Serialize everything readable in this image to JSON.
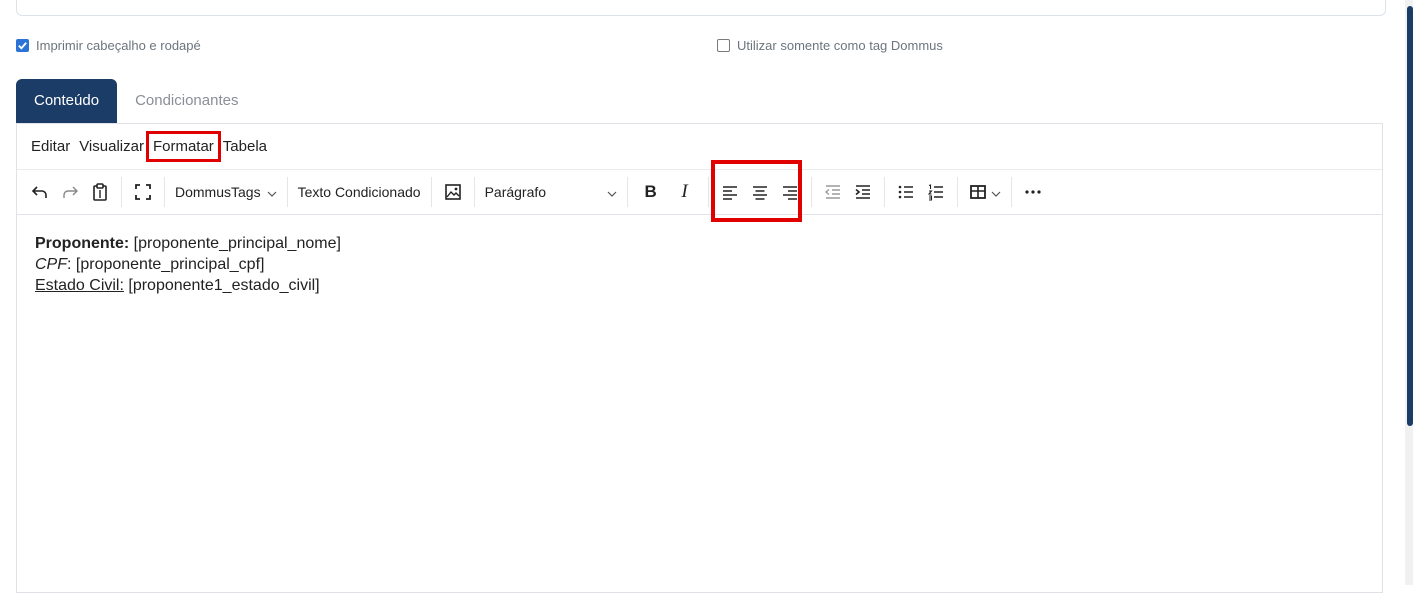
{
  "options": {
    "print_header_footer": {
      "label": "Imprimir cabeçalho e rodapé",
      "checked": true
    },
    "use_as_tag": {
      "label": "Utilizar somente como tag Dommus",
      "checked": false
    }
  },
  "tabs": [
    {
      "label": "Conteúdo",
      "active": true
    },
    {
      "label": "Condicionantes",
      "active": false
    }
  ],
  "menubar": [
    "Editar",
    "Visualizar",
    "Formatar",
    "Tabela"
  ],
  "toolbar": {
    "dommus_tags": "DommusTags",
    "texto_condicionado": "Texto Condicionado",
    "paragraph": "Parágrafo",
    "bold": "B",
    "italic": "I"
  },
  "content": {
    "line1_label": "Proponente:",
    "line1_value": " [proponente_principal_nome]",
    "line2_label": "CPF",
    "line2_value": ": [proponente_principal_cpf]",
    "line3_label": "Estado Civil:",
    "line3_value": " [proponente1_estado_civil]"
  },
  "colors": {
    "accent": "#1b3c66",
    "checkbox": "#2b73d6",
    "highlight": "#e00000"
  }
}
